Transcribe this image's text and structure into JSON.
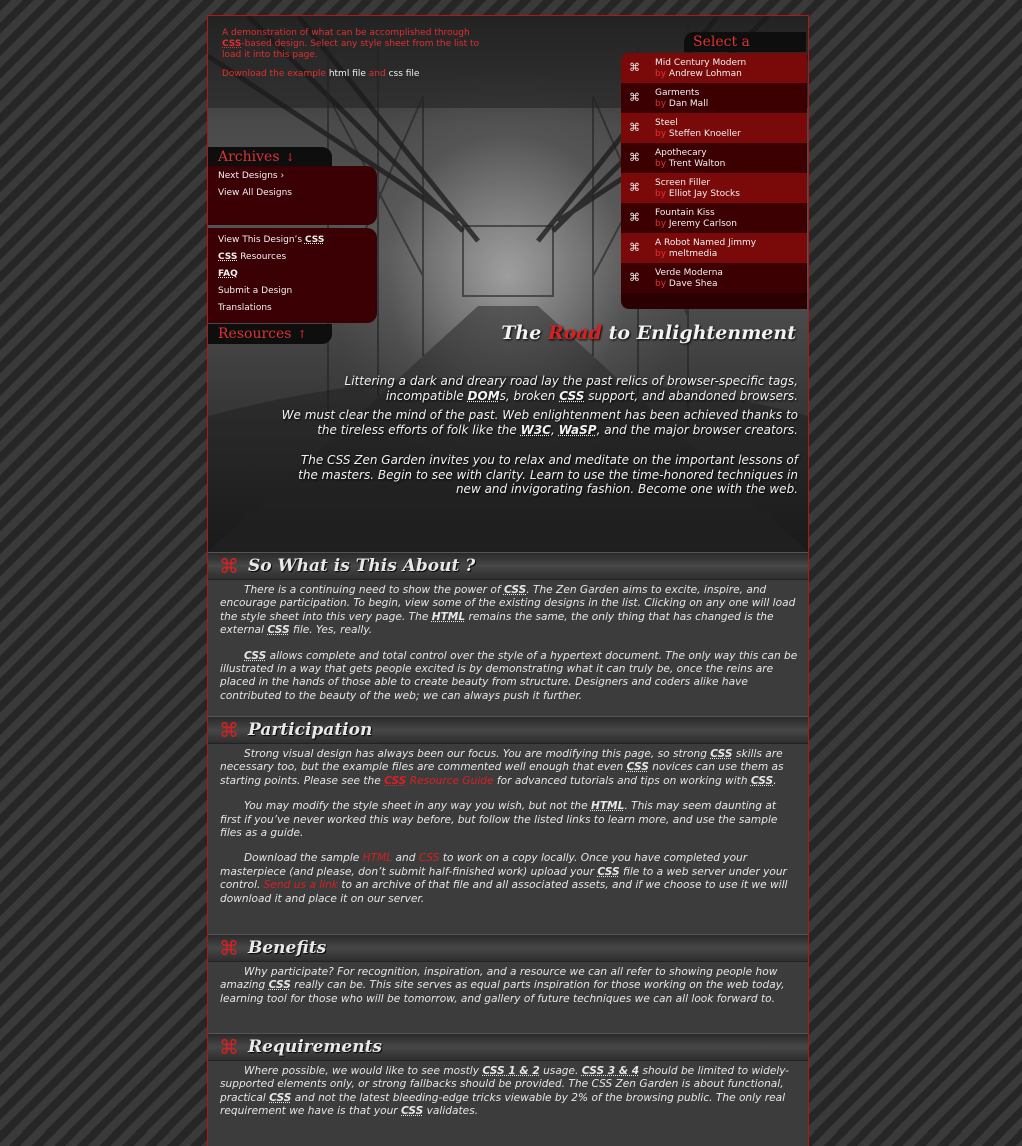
{
  "intro": {
    "line1_pre": "A demonstration of what can be accomplished through ",
    "line1_abbr": "CSS",
    "line1_post": "-based design. Select any style sheet from the list to load it into this page.",
    "download_pre": "Download the example ",
    "html_file": "html file",
    "and": " and ",
    "css_file": "css file"
  },
  "select": {
    "label": "Select a Design",
    "arrow": "↓",
    "by": "by ",
    "designs": [
      {
        "title": "Mid Century Modern",
        "author": "Andrew Lohman"
      },
      {
        "title": "Garments",
        "author": "Dan Mall"
      },
      {
        "title": "Steel",
        "author": "Steffen Knoeller"
      },
      {
        "title": "Apothecary",
        "author": "Trent Walton"
      },
      {
        "title": "Screen Filler",
        "author": "Elliot Jay Stocks"
      },
      {
        "title": "Fountain Kiss",
        "author": "Jeremy Carlson"
      },
      {
        "title": "A Robot Named Jimmy",
        "author": "meltmedia"
      },
      {
        "title": "Verde Moderna",
        "author": "Dave Shea"
      }
    ]
  },
  "archives": {
    "label": "Archives",
    "arrow": "↓",
    "next": "Next Designs ›",
    "view_all": "View All Designs"
  },
  "resources": {
    "label": "Resources",
    "arrow": "↑",
    "view_css_pre": "View This Design’s ",
    "css": "CSS",
    "css_resources_post": " Resources",
    "faq": "FAQ",
    "submit": "Submit a Design",
    "translations": "Translations"
  },
  "road": {
    "the": "The ",
    "road": "Road",
    "rest": " to Enlightenment"
  },
  "preamble": {
    "p1_a": "Littering a dark and dreary road lay the past relics of browser-specific tags, incompatible ",
    "dom": "DOM",
    "p1_b": "s, broken ",
    "css": "CSS",
    "p1_c": " support, and abandoned browsers.",
    "p2_a": "We must clear the mind of the past. Web enlightenment has been achieved thanks to the tireless efforts of folk like the ",
    "w3c": "W3C",
    "comma": ", ",
    "wasp": "WaSP",
    "p2_b": ", and the major browser creators.",
    "p3": "The CSS Zen Garden invites you to relax and meditate on the important lessons of the masters. Begin to see with clarity. Learn to use the time-honored techniques in new and invigorating fashion. Become one with the web."
  },
  "sections": {
    "symbol": "⌘",
    "about": {
      "title": "So What is This About ?",
      "p1_a": "There is a continuing need to show the power of ",
      "css": "CSS",
      "p1_b": ". The Zen Garden aims to excite, inspire, and encourage participation. To begin, view some of the existing designs in the list. Clicking on any one will load the style sheet into this very page. The ",
      "html": "HTML",
      "p1_c": " remains the same, the only thing that has changed is the external ",
      "p1_d": " file. Yes, really.",
      "p2_b": " allows complete and total control over the style of a hypertext document. The only way this can be illustrated in a way that gets people excited is by demonstrating what it can truly be, once the reins are placed in the hands of those able to create beauty from structure. Designers and coders alike have contributed to the beauty of the web; we can always push it further."
    },
    "participation": {
      "title": "Participation",
      "p1_a": "Strong visual design has always been our focus. You are modifying this page, so strong ",
      "css": "CSS",
      "p1_b": " skills are necessary too, but the example files are commented well enough that even ",
      "p1_c": " novices can use them as starting points. Please see the ",
      "resource_guide": " Resource Guide",
      "p1_d": " for advanced tutorials and tips on working with ",
      "period": ".",
      "p2_a": "You may modify the style sheet in any way you wish, but not the ",
      "html": "HTML",
      "p2_b": ". This may seem daunting at first if you’ve never worked this way before, but follow the listed links to learn more, and use the sample files as a guide.",
      "p3_a": "Download the sample ",
      "and": " and ",
      "p3_b": " to work on a copy locally. Once you have completed your masterpiece (and please, don’t submit half-finished work) upload your ",
      "p3_c": " file to a web server under your control. ",
      "send_link": "Send us a link",
      "p3_d": " to an archive of that file and all associated assets, and if we choose to use it we will download it and place it on our server."
    },
    "benefits": {
      "title": "Benefits",
      "p1_a": "Why participate? For recognition, inspiration, and a resource we can all refer to showing people how amazing ",
      "css": "CSS",
      "p1_b": " really can be. This site serves as equal parts inspiration for those working on the web today, learning tool for those who will be tomorrow, and gallery of future techniques we can all look forward to."
    },
    "requirements": {
      "title": "Requirements",
      "p1_a": "Where possible, we would like to see mostly ",
      "css12": "CSS 1 & 2",
      "p1_b": " usage. ",
      "css34": "CSS 3 & 4",
      "p1_c": " should be limited to widely-supported elements only, or strong fallbacks should be provided. The CSS Zen Garden is about functional, practical ",
      "css": "CSS",
      "p1_d": " and not the latest bleeding-edge tricks viewable by 2% of the browsing public. The only real requirement we have is that your ",
      "p1_e": " validates."
    }
  }
}
